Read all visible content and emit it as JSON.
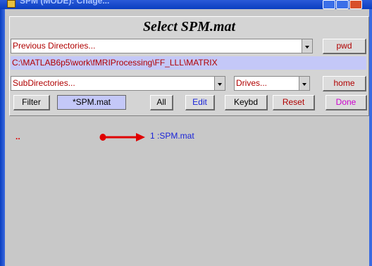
{
  "window": {
    "title": "SPM (MODE): Chage..."
  },
  "panel": {
    "title": "Select SPM.mat",
    "previous_directories": "Previous Directories...",
    "pwd_label": "pwd",
    "current_path": "C:\\MATLAB6p5\\work\\fMRIProcessing\\FF_LLL\\MATRIX",
    "subdirectories": "SubDirectories...",
    "drives": "Drives...",
    "home_label": "home",
    "filter_label": "Filter",
    "filter_value": "*SPM.mat",
    "all_label": "All",
    "edit_label": "Edit",
    "keybd_label": "Keybd",
    "reset_label": "Reset",
    "done_label": "Done"
  },
  "listing": {
    "parent_entry": "..",
    "file_entry": "1 :SPM.mat"
  },
  "colors": {
    "path_bg": "#c4c8f8",
    "red_text": "#b00000",
    "blue_text": "#1a24d8",
    "magenta_text": "#cc00cc",
    "arrow": "#e00000"
  },
  "icons": [
    "dropdown-arrow-icon",
    "minimize-icon",
    "maximize-icon",
    "close-icon",
    "red-arrow-annotation"
  ]
}
